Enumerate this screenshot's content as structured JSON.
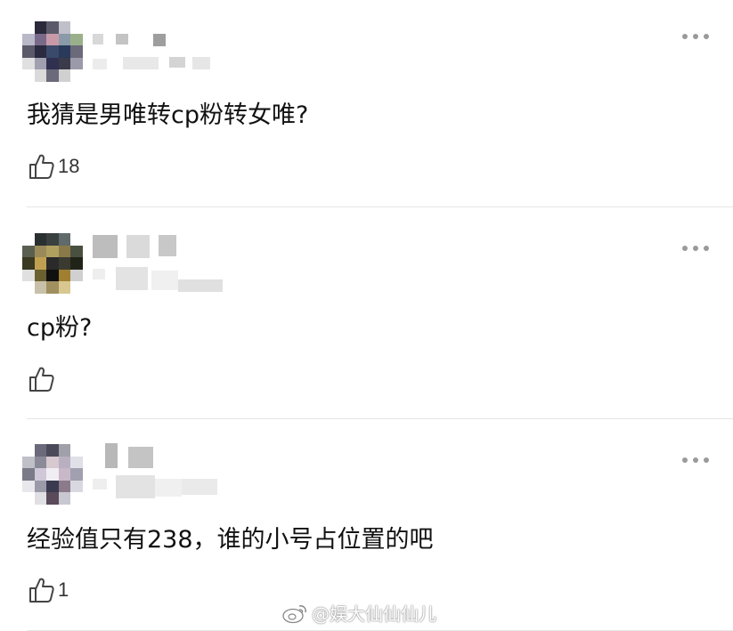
{
  "comments": [
    {
      "text": "我猜是男唯转cp粉转女唯?",
      "likes": "18",
      "avatar_colors": [
        "#fff",
        "#2a2a3a",
        "#5a5a6a",
        "#c0c0c8",
        "#fff",
        "#b8b8c8",
        "#7a6a8a",
        "#c89aa8",
        "#8a9aa8",
        "#9ab08a",
        "#5a5a6a",
        "#2a2a40",
        "#3a4a6a",
        "#2a3a5a",
        "#6a6a7a",
        "#e0e0e0",
        "#a0a0b0",
        "#303050",
        "#3a3a4a",
        "#9a9aa8",
        "#fff",
        "#dadada",
        "#6a6a7a",
        "#d0d0d0",
        "#fff"
      ]
    },
    {
      "text": "cp粉?",
      "likes": "",
      "avatar_colors": [
        "#fff",
        "#2a3030",
        "#3a4040",
        "#606a6a",
        "#fff",
        "#5a6050",
        "#9a8a5a",
        "#b0a060",
        "#8a7a4a",
        "#4a5040",
        "#3a3a20",
        "#c0a050",
        "#2a2a2a",
        "#3a3a30",
        "#202418",
        "#e0e0e0",
        "#6a6030",
        "#101010",
        "#a08030",
        "#d0d0d0",
        "#fff",
        "#c8c0a8",
        "#a09060",
        "#d8c890",
        "#fff"
      ]
    },
    {
      "text": "经验值只有238，谁的小号占位置的吧",
      "likes": "1",
      "avatar_colors": [
        "#fff",
        "#6a6a7a",
        "#4a4a5a",
        "#a0a0a8",
        "#fff",
        "#c0c0c8",
        "#8a8a98",
        "#d8c8d0",
        "#b8b0c0",
        "#e0e0e8",
        "#7a7a88",
        "#d0c8d8",
        "#f0eef2",
        "#c8b8c8",
        "#a0a0b0",
        "#e8e8ec",
        "#9a9aa8",
        "#3a3a50",
        "#8a7a8a",
        "#d8d8e0",
        "#fff",
        "#e0e0e4",
        "#5a4a5a",
        "#c8c8d0",
        "#fff"
      ]
    }
  ],
  "watermark": "@娱大仙仙仙儿"
}
